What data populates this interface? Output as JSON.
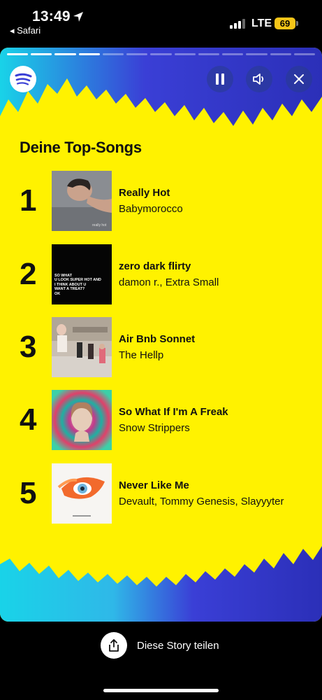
{
  "status": {
    "time": "13:49",
    "back_app": "◂ Safari",
    "network": "LTE",
    "battery": "69"
  },
  "story": {
    "segments_total": 13,
    "segments_done": 4,
    "heading": "Deine Top-Songs",
    "colors": {
      "background": "#fff200",
      "edge_blue": "#3a3fd6",
      "edge_cyan": "#19d3e8",
      "text": "#111111"
    },
    "songs": [
      {
        "rank": "1",
        "title": "Really Hot",
        "artist": "Babymorocco",
        "cover_text": "really hot"
      },
      {
        "rank": "2",
        "title": "zero dark flirty",
        "artist": "damon r., Extra Small",
        "cover_text": "SO WHAT\nU LOOK SUPER HOT AND\nI THINK ABOUT U\nWANT A TREAT?\nOK"
      },
      {
        "rank": "3",
        "title": "Air Bnb Sonnet",
        "artist": "The Hellp"
      },
      {
        "rank": "4",
        "title": "So What If I'm A Freak",
        "artist": "Snow Strippers"
      },
      {
        "rank": "5",
        "title": "Never Like Me",
        "artist": "Devault, Tommy Genesis, Slayyyter"
      }
    ]
  },
  "controls": {
    "logo_icon": "spotify-icon",
    "pause_icon": "pause-icon",
    "sound_icon": "speaker-icon",
    "close_icon": "close-icon"
  },
  "share": {
    "label": "Diese Story teilen",
    "icon": "share-icon"
  }
}
